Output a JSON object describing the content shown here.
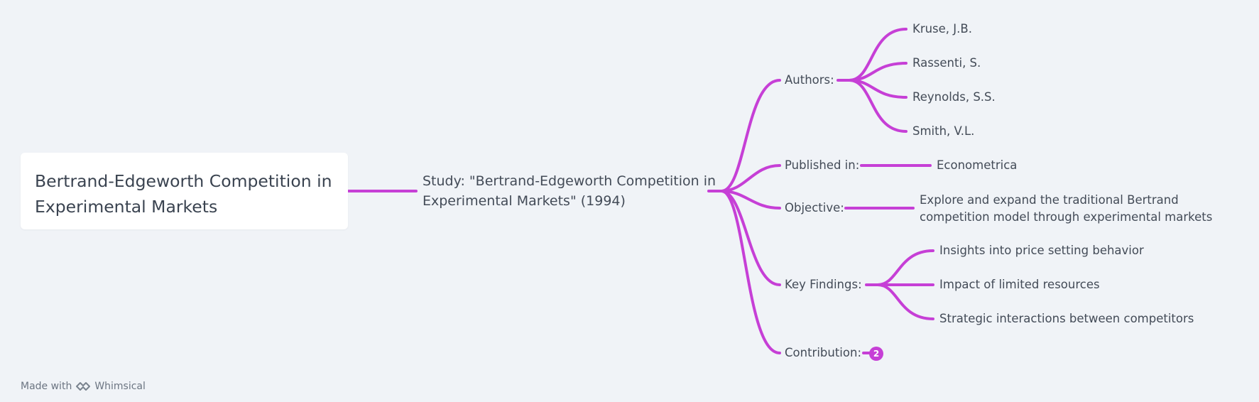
{
  "root": {
    "title": "Bertrand-Edgeworth Competition in Experimental Markets"
  },
  "study": {
    "label": "Study: \"Bertrand-Edgeworth Competition in Experimental Markets\" (1994)"
  },
  "branches": {
    "authors": {
      "label": "Authors:",
      "items": [
        "Kruse, J.B.",
        "Rassenti, S.",
        "Reynolds, S.S.",
        "Smith, V.L."
      ]
    },
    "published": {
      "label": "Published in:",
      "value": "Econometrica"
    },
    "objective": {
      "label": "Objective:",
      "value": "Explore and expand the traditional Bertrand competition model through experimental markets"
    },
    "findings": {
      "label": "Key Findings:",
      "items": [
        "Insights into price setting behavior",
        "Impact of limited resources",
        "Strategic interactions between competitors"
      ]
    },
    "contribution": {
      "label": "Contribution:",
      "collapsed_count": "2"
    }
  },
  "footer": {
    "made_with": "Made with",
    "brand": "Whimsical"
  },
  "colors": {
    "connector": "#c63fd6",
    "background": "#f0f3f7",
    "card": "#ffffff",
    "text": "#434b57"
  }
}
